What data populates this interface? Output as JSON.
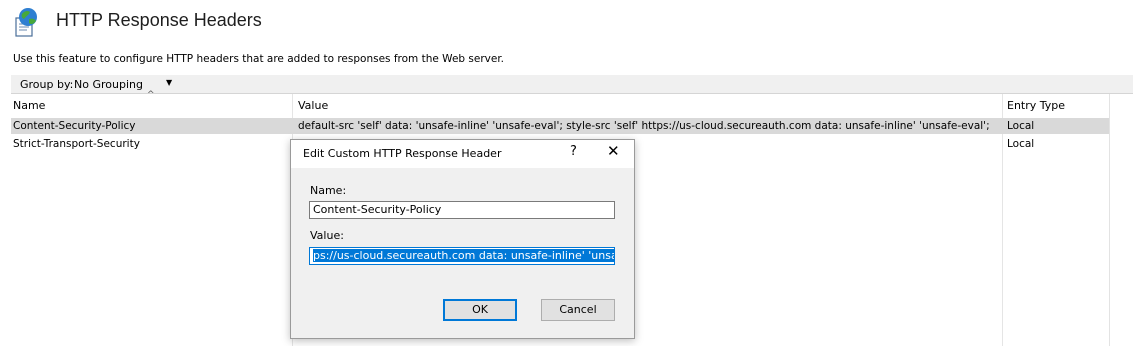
{
  "header": {
    "title": "HTTP Response Headers",
    "icon": "globe-document-icon",
    "description": "Use this feature to configure HTTP headers that are added to responses from the Web server."
  },
  "toolbar": {
    "group_by_label": "Group by:",
    "group_by_value": "No Grouping"
  },
  "grid": {
    "columns": [
      "Name",
      "Value",
      "Entry Type"
    ],
    "rows": [
      {
        "name": "Content-Security-Policy",
        "value": "default-src 'self' data: 'unsafe-inline' 'unsafe-eval'; style-src 'self' https://us-cloud.secureauth.com data: unsafe-inline' 'unsafe-eval';",
        "entry_type": "Local",
        "selected": true
      },
      {
        "name": "Strict-Transport-Security",
        "value": "",
        "entry_type": "Local",
        "selected": false
      }
    ]
  },
  "dialog": {
    "title": "Edit Custom HTTP Response Header",
    "help": "?",
    "close": "✕",
    "name_label": "Name:",
    "name_value": "Content-Security-Policy",
    "value_label": "Value:",
    "value_visible": "ps://us-cloud.secureauth.com data: unsafe-inline' 'unsafe-eval';",
    "ok_label": "OK",
    "cancel_label": "Cancel"
  },
  "colors": {
    "selection": "#0078d7",
    "row_selected": "#d9d9d9"
  }
}
